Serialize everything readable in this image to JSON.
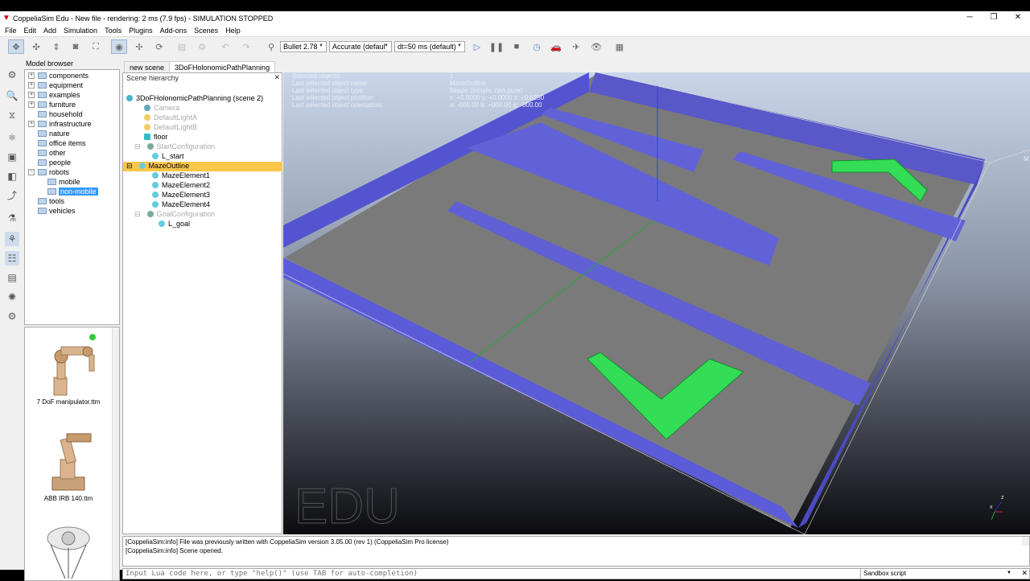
{
  "window": {
    "title": "CoppeliaSim Edu - New file - rendering: 2 ms (7.9 fps) - SIMULATION STOPPED"
  },
  "menu": [
    "File",
    "Edit",
    "Add",
    "Simulation",
    "Tools",
    "Plugins",
    "Add-ons",
    "Scenes",
    "Help"
  ],
  "toolbar": {
    "engine": "Bullet 2.78",
    "accuracy": "Accurate (defaul",
    "dt": "dt=50 ms (default)"
  },
  "model_browser": {
    "title": "Model browser",
    "items": [
      "components",
      "equipment",
      "examples",
      "furniture",
      "household",
      "infrastructure",
      "nature",
      "office items",
      "other",
      "people",
      "robots",
      "mobile",
      "non-mobile",
      "tools",
      "vehicles"
    ],
    "thumbnails": [
      "7 DoF manipulator.ttm",
      "ABB IRB 140.ttm"
    ]
  },
  "tabs": [
    "new scene",
    "3DoFHolonomicPathPlanning"
  ],
  "scene": {
    "title": "Scene hierarchy",
    "root": "3DoFHolonomicPathPlanning (scene 2)",
    "items": [
      "Camera",
      "DefaultLightA",
      "DefaultLightB",
      "floor",
      "StartConfiguration",
      "L_start",
      "MazeOutline",
      "MazeElement1",
      "MazeElement2",
      "MazeElement3",
      "MazeElement4",
      "GoalConfiguration",
      "L_goal"
    ]
  },
  "viewport": {
    "info_labels": [
      "Selected objects:",
      "Last selected object name:",
      "Last selected object type:",
      "Last selected object position:",
      "Last selected object orientation:"
    ],
    "info_values": [
      "1",
      "MazeOutline",
      "Shape (simple, non-pure)",
      "x: +0.0000    y: +0.0000    z: +0.0250",
      "a: -000.00    b: +000.00    g: -000.00"
    ],
    "watermark": "EDU",
    "axis_x": "x",
    "axis_z": "z",
    "axis_partial": "M"
  },
  "console": {
    "lines": [
      "[CoppeliaSim:info]    File was previously written with CoppeliaSim version 3.05.00 (rev 1) (CoppeliaSim Pro license)",
      "[CoppeliaSim:info]    Scene opened."
    ],
    "placeholder": "Input Lua code here, or type \"help()\" (use TAB for auto-completion)",
    "script_select": "Sandbox script"
  },
  "colors": {
    "maze": "#5b5bd6",
    "floor": "#7a7a7a",
    "green": "#33dd55",
    "selection": "#fbc74a"
  }
}
